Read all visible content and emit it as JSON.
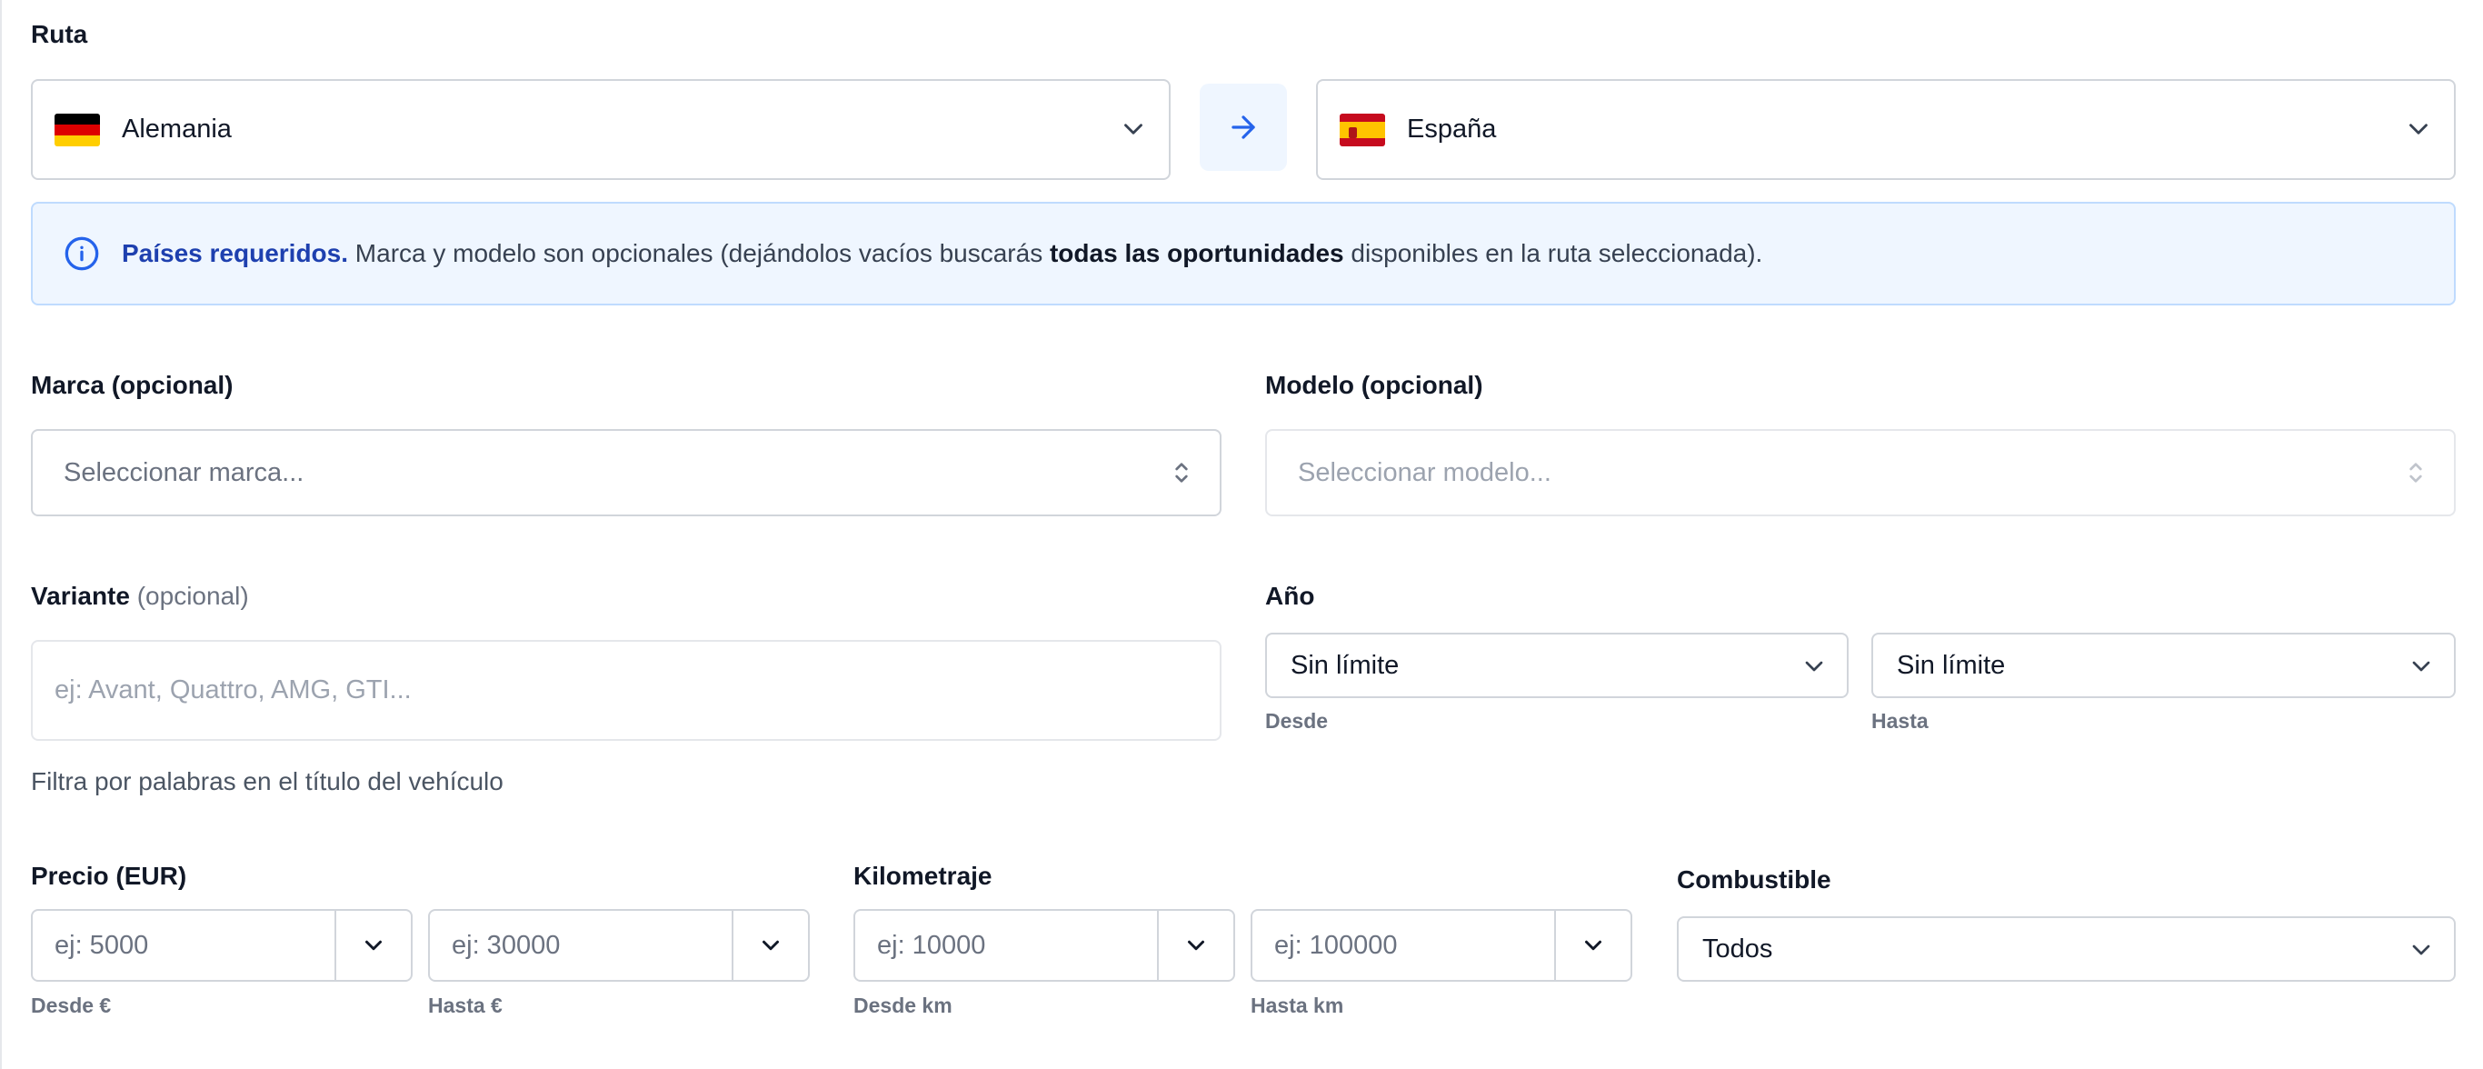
{
  "route": {
    "label": "Ruta",
    "origin": {
      "country": "Alemania",
      "flag_icon": "germany-flag-icon"
    },
    "destination": {
      "country": "España",
      "flag_icon": "spain-flag-icon"
    },
    "swap_icon": "arrow-right-icon"
  },
  "notice": {
    "lead": "Países requeridos.",
    "text_before": " Marca y modelo son opcionales (dejándolos vacíos buscarás ",
    "bold": "todas las oportunidades",
    "text_after": " disponibles en la ruta seleccionada).",
    "icon": "info-icon"
  },
  "brand": {
    "label": "Marca (opcional)",
    "placeholder": "Seleccionar marca..."
  },
  "model": {
    "label": "Modelo (opcional)",
    "placeholder": "Seleccionar modelo..."
  },
  "variant": {
    "label": "Variante",
    "optional": "(opcional)",
    "placeholder": "ej: Avant, Quattro, AMG, GTI...",
    "helper": "Filtra por palabras en el título del vehículo"
  },
  "year": {
    "label": "Año",
    "from": {
      "value": "Sin límite",
      "caption": "Desde"
    },
    "to": {
      "value": "Sin límite",
      "caption": "Hasta"
    }
  },
  "price": {
    "label": "Precio (EUR)",
    "from": {
      "placeholder": "ej: 5000",
      "caption": "Desde €"
    },
    "to": {
      "placeholder": "ej: 30000",
      "caption": "Hasta €"
    }
  },
  "mileage": {
    "label": "Kilometraje",
    "from": {
      "placeholder": "ej: 10000",
      "caption": "Desde km"
    },
    "to": {
      "placeholder": "ej: 100000",
      "caption": "Hasta km"
    }
  },
  "fuel": {
    "label": "Combustible",
    "value": "Todos"
  },
  "colors": {
    "accent": "#2563eb",
    "info_bg": "#eff6ff",
    "info_border": "#bfdbfe",
    "info_text": "#1e40af",
    "border": "#d1d5db"
  }
}
